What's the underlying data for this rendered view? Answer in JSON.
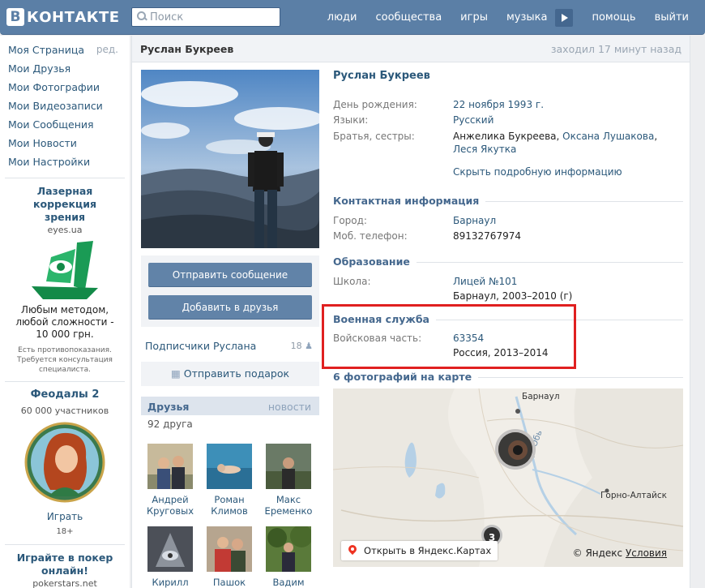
{
  "header": {
    "logo_letter": "В",
    "logo_word": "КОНТАКТЕ",
    "search_placeholder": "Поиск",
    "nav": [
      "люди",
      "сообщества",
      "игры",
      "музыка",
      "помощь",
      "выйти"
    ]
  },
  "sidebar": {
    "items": [
      "Моя Страница",
      "Мои Друзья",
      "Мои Фотографии",
      "Мои Видеозаписи",
      "Мои Сообщения",
      "Мои Новости",
      "Мои Настройки"
    ],
    "edit_label": "ред.",
    "ad1": {
      "title": "Лазерная коррекция зрения",
      "domain": "eyes.ua",
      "text": "Любым методом, любой сложности - 10 000 грн.",
      "disclaimer": "Есть противопоказания. Требуется консультация специалиста."
    },
    "ad2": {
      "title": "Феодалы 2",
      "members": "60 000 участников",
      "cta": "Играть",
      "age": "18+"
    },
    "ad3": {
      "title": "Играйте в покер онлайн!",
      "domain": "pokerstars.net"
    }
  },
  "profile": {
    "name": "Руслан Букреев",
    "last_seen": "заходил 17 минут назад",
    "buttons": {
      "send_message": "Отправить сообщение",
      "add_friend": "Добавить в друзья"
    },
    "subscribers_label": "Подписчики Руслана",
    "subscribers_count": "18",
    "gift_label": "Отправить подарок",
    "friends": {
      "title": "Друзья",
      "news": "новости",
      "count": "92 друга",
      "list": [
        {
          "first": "Андрей",
          "last": "Круговых"
        },
        {
          "first": "Роман",
          "last": "Климов"
        },
        {
          "first": "Макс",
          "last": "Еременко"
        },
        {
          "first": "Кирилл",
          "last": ""
        },
        {
          "first": "Пашок",
          "last": ""
        },
        {
          "first": "Вадим",
          "last": ""
        }
      ]
    },
    "info": {
      "birthday_label": "День рождения:",
      "birthday_value": "22 ноября 1993 г.",
      "languages_label": "Языки:",
      "languages_value": "Русский",
      "siblings_label": "Братья, сестры:",
      "siblings": [
        "Анжелика Букреева",
        "Оксана Лушакова",
        "Леся Якутка"
      ],
      "hide_details": "Скрыть подробную информацию"
    },
    "contacts": {
      "title": "Контактная информация",
      "city_label": "Город:",
      "city_value": "Барнаул",
      "phone_label": "Моб. телефон:",
      "phone_value": "89132767974"
    },
    "education": {
      "title": "Образование",
      "school_label": "Школа:",
      "school_value": "Лицей №101",
      "school_detail": "Барнаул, 2003–2010 (г)"
    },
    "military": {
      "title": "Военная служба",
      "unit_label": "Войсковая часть:",
      "unit_value": "63354",
      "unit_detail": "Россия, 2013–2014"
    },
    "map": {
      "title": "6 фотографий на карте",
      "open_label": "Открыть в Яндекс.Картах",
      "copyright": "© Яндекс",
      "terms": "Условия",
      "labels": {
        "barnaul": "Барнаул",
        "gorno": "Горно-Алтайск",
        "river": "р. Обь"
      },
      "cluster_count": "3"
    }
  },
  "colors": {
    "header": "#5b7fa6",
    "link": "#2b587a",
    "button": "#6183a8",
    "highlight": "#e02020"
  }
}
